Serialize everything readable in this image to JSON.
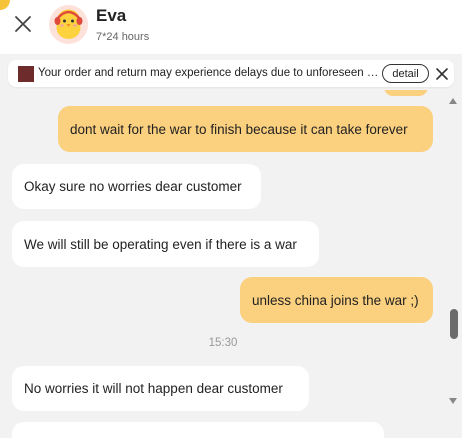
{
  "header": {
    "agent_name": "Eva",
    "agent_hours": "7*24 hours",
    "close_icon": "close-icon",
    "avatar_icon": "chick-mascot-avatar"
  },
  "notice": {
    "text": "Your order and return may experience delays due to unforeseen circumstances",
    "detail_label": "detail",
    "swatch_color": "#6d2b2b"
  },
  "messages": [
    {
      "sender": "user",
      "text": "dont wait for the war to finish because it can take forever"
    },
    {
      "sender": "agent",
      "text": "Okay sure no worries dear customer"
    },
    {
      "sender": "agent",
      "text": "We will still be operating even if there is a war"
    },
    {
      "sender": "user",
      "text": "unless china joins the war ;)"
    },
    {
      "sender": "agent",
      "text": "No worries it will not happen dear customer"
    }
  ],
  "timestamp": "15:30",
  "colors": {
    "user_bubble": "#fbd07f",
    "agent_bubble": "#ffffff",
    "chat_background": "#f2f2f2",
    "accent": "#f7c33a"
  }
}
